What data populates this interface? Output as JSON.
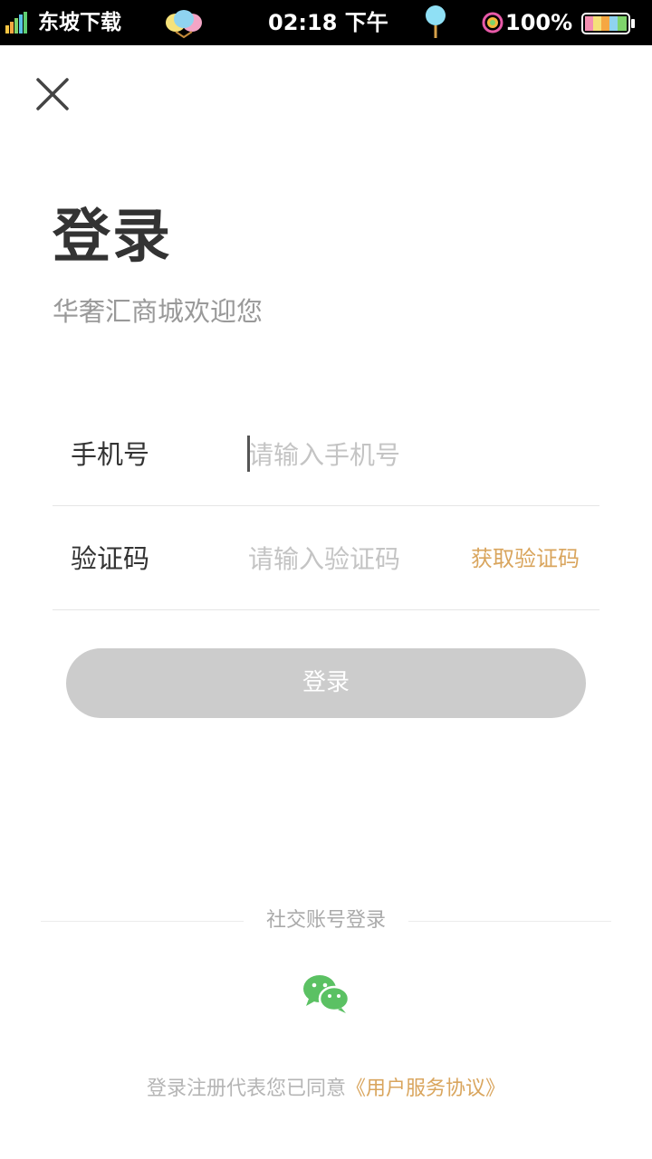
{
  "status_bar": {
    "carrier": "东坡下载",
    "time": "02:18 下午",
    "battery": "100%",
    "icons": [
      "signal-icon",
      "balloon-icon",
      "location-pin-icon",
      "ring-icon",
      "battery-icon"
    ]
  },
  "header": {
    "close_icon": "close-icon"
  },
  "login": {
    "title": "登录",
    "subtitle": "华奢汇商城欢迎您",
    "phone": {
      "label": "手机号",
      "placeholder": "请输入手机号",
      "value": ""
    },
    "code": {
      "label": "验证码",
      "placeholder": "请输入验证码",
      "value": "",
      "get_code": "获取验证码"
    },
    "submit": "登录"
  },
  "social": {
    "label": "社交账号登录",
    "icon": "wechat-icon"
  },
  "agreement": {
    "text": "登录注册代表您已同意",
    "link": "《用户服务协议》"
  },
  "colors": {
    "accent": "#d9a55d",
    "button_disabled": "#cccccc",
    "wechat": "#5bc163",
    "text_primary": "#333333",
    "text_secondary": "#999999"
  }
}
